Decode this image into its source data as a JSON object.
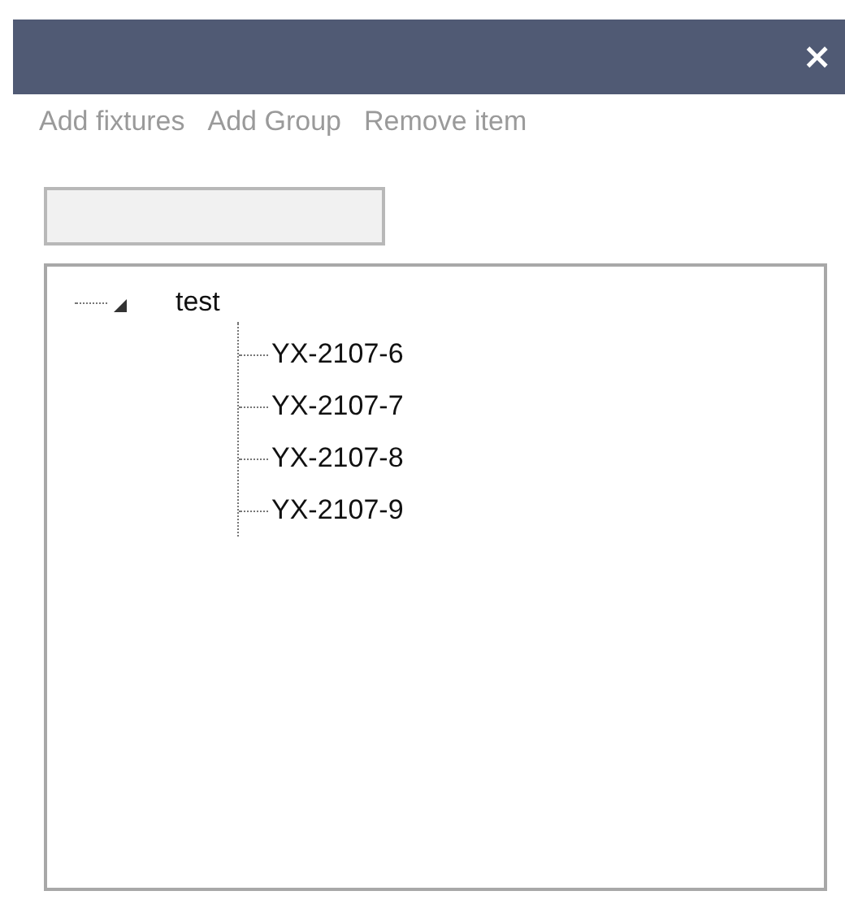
{
  "window": {
    "close_label": "×"
  },
  "toolbar": [
    "Add fixtures",
    "Add Group",
    "Remove item"
  ],
  "tree": [
    {
      "label": "test",
      "expanded": true,
      "children": [
        {
          "label": "YX-2107-6"
        },
        {
          "label": "YX-2107-7"
        },
        {
          "label": "YX-2107-8"
        },
        {
          "label": "YX-2107-9"
        }
      ]
    }
  ]
}
